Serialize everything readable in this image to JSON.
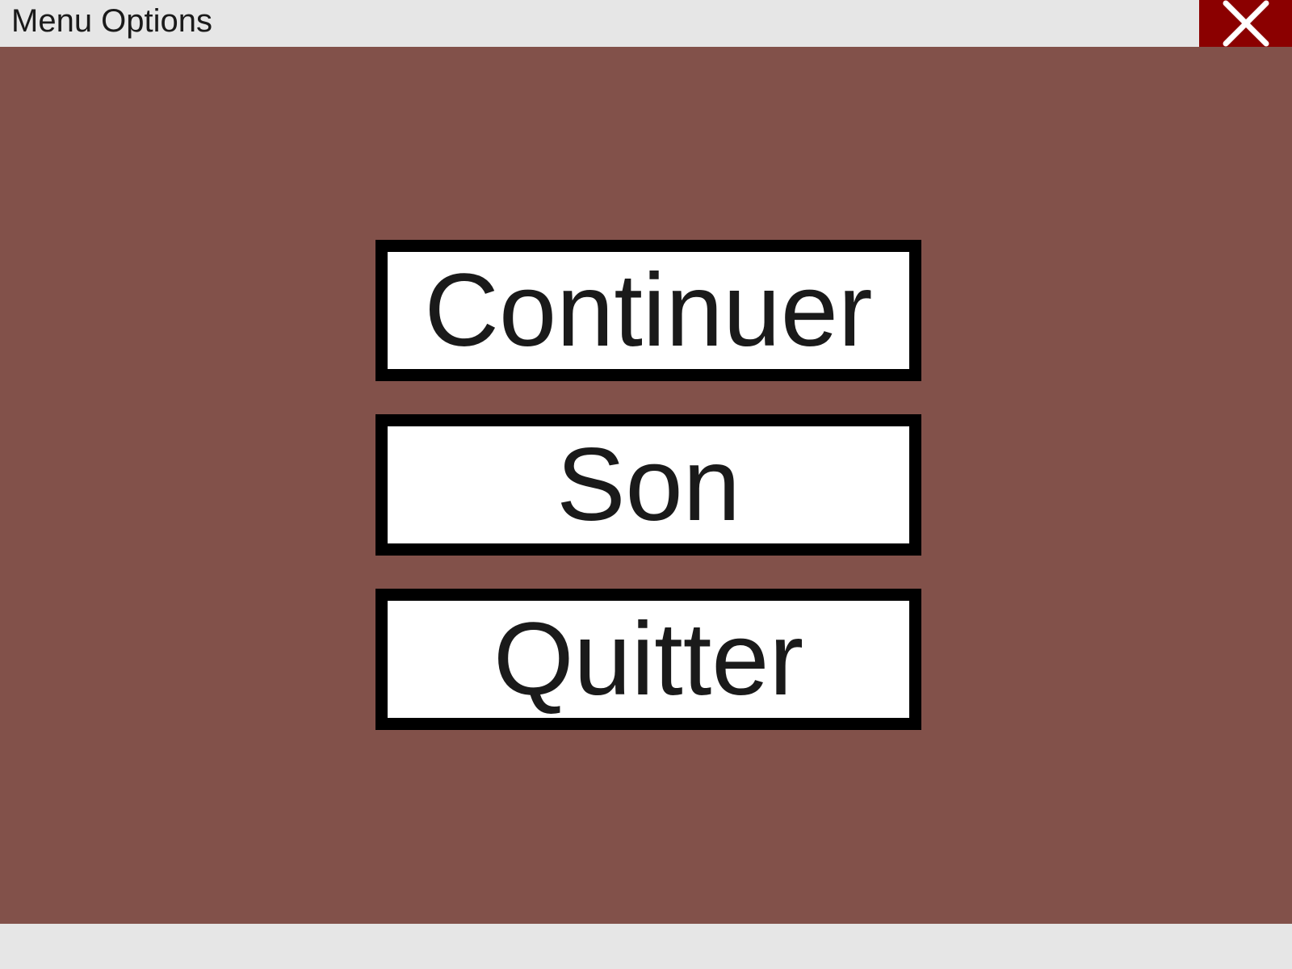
{
  "window": {
    "title": "Menu Options",
    "close_icon": "close-x-icon"
  },
  "menu": {
    "buttons": [
      {
        "label": "Continuer"
      },
      {
        "label": "Son"
      },
      {
        "label": "Quitter"
      }
    ]
  },
  "colors": {
    "title_bar": "#e6e6e6",
    "close_button": "#8b0000",
    "background": "#82514a",
    "button_fill": "#ffffff",
    "button_border": "#000000",
    "text": "#1a1a1a"
  }
}
